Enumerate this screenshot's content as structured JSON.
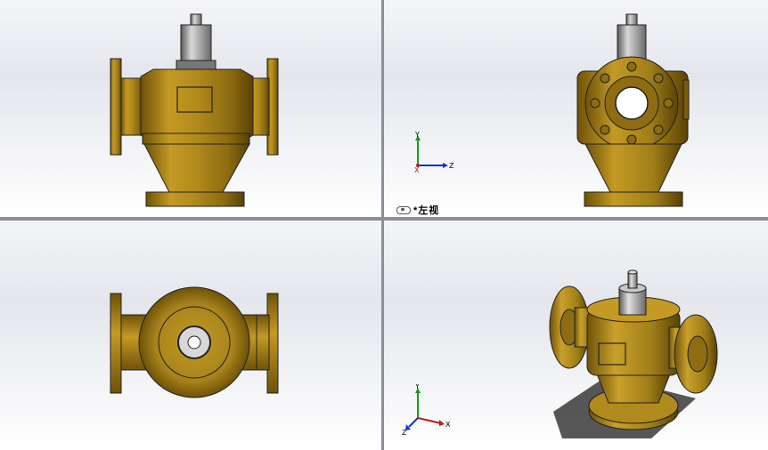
{
  "window": {
    "layout": "four-viewport",
    "background_gradient": [
      "#f4f5f8",
      "#ffffff"
    ]
  },
  "viewports": {
    "top_left": {
      "view": "front",
      "model": "valve-body"
    },
    "top_right": {
      "view": "left",
      "label": "*左视",
      "label_icon": "view-eye-icon",
      "triad": {
        "axes": [
          "Y",
          "Z",
          "X"
        ]
      }
    },
    "bottom_left": {
      "view": "top",
      "model": "valve-body"
    },
    "bottom_right": {
      "view": "isometric",
      "triad": {
        "axes": [
          "Y",
          "X",
          "Z"
        ]
      }
    }
  },
  "colors": {
    "brass": "#b8901e",
    "brass_dark": "#6e5208",
    "steel": "#9a9a9a",
    "axis_y": "#1a9a1a",
    "axis_x": "#c01a1a",
    "axis_z": "#1a2fc8"
  }
}
